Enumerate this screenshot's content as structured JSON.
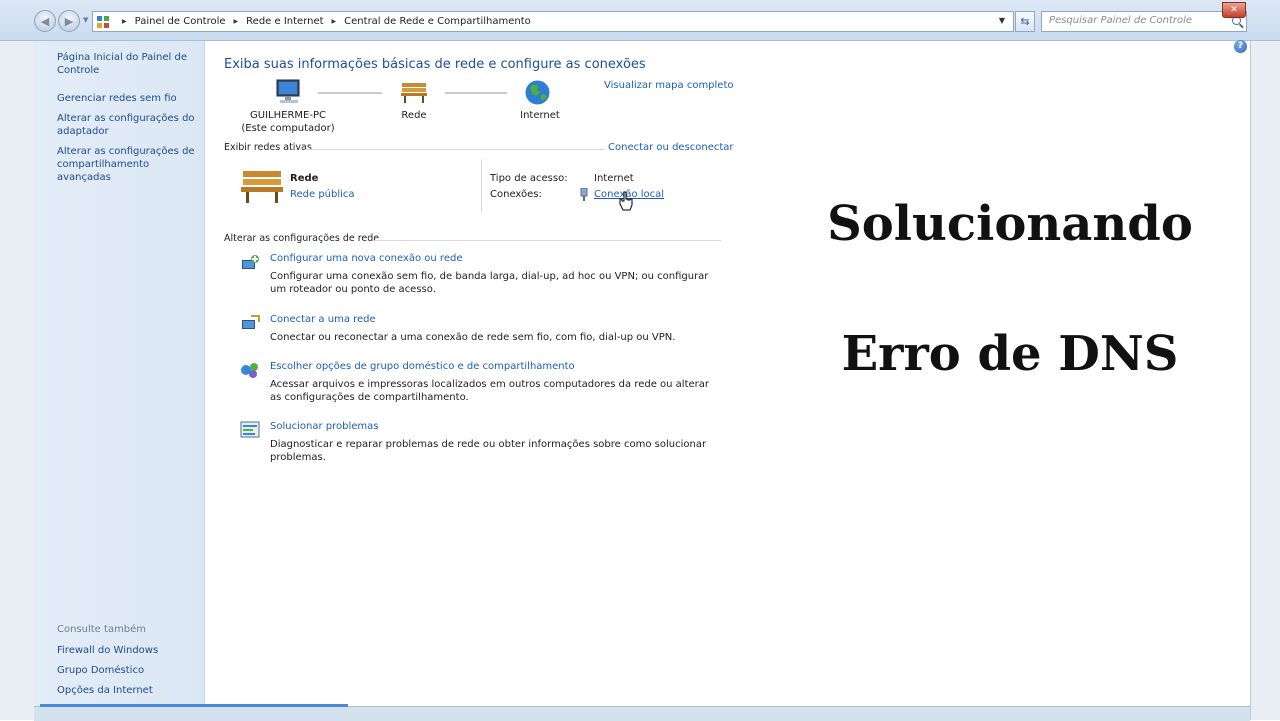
{
  "breadcrumb": [
    "Painel de Controle",
    "Rede e Internet",
    "Central de Rede e Compartilhamento"
  ],
  "search": {
    "placeholder": "Pesquisar Painel de Controle"
  },
  "sidebar": {
    "links": [
      "Página Inicial do Painel de Controle",
      "Gerenciar redes sem fio",
      "Alterar as configurações do adaptador",
      "Alterar as configurações de compartilhamento avançadas"
    ],
    "see_also_heading": "Consulte também",
    "see_also": [
      "Firewall do Windows",
      "Grupo Doméstico",
      "Opções da Internet"
    ]
  },
  "main": {
    "title": "Exiba suas informações básicas de rede e configure as conexões",
    "full_map_link": "Visualizar mapa completo",
    "map": {
      "computer_name": "GUILHERME-PC",
      "computer_sub": "(Este computador)",
      "network": "Rede",
      "internet": "Internet"
    },
    "active_networks_heading": "Exibir redes ativas",
    "connect_disconnect_link": "Conectar ou desconectar",
    "active_network": {
      "name": "Rede",
      "type_link": "Rede pública",
      "access_type_label": "Tipo de acesso:",
      "access_type_value": "Internet",
      "connections_label": "Conexões:",
      "connections_value": "Conexão local"
    },
    "change_settings_heading": "Alterar as configurações de rede",
    "tasks": [
      {
        "title": "Configurar uma nova conexão ou rede",
        "desc": "Configurar uma conexão sem fio, de banda larga, dial-up, ad hoc ou VPN; ou configurar um roteador ou ponto de acesso."
      },
      {
        "title": "Conectar a uma rede",
        "desc": "Conectar ou reconectar a uma conexão de rede sem fio, com fio, dial-up ou VPN."
      },
      {
        "title": "Escolher opções de grupo doméstico e de compartilhamento",
        "desc": "Acessar arquivos e impressoras localizados em outros computadores da rede ou alterar as configurações de compartilhamento."
      },
      {
        "title": "Solucionar problemas",
        "desc": "Diagnosticar e reparar problemas de rede ou obter informações sobre como solucionar problemas."
      }
    ]
  },
  "overlay": {
    "line1": "Solucionando",
    "line2": "Erro de DNS"
  }
}
